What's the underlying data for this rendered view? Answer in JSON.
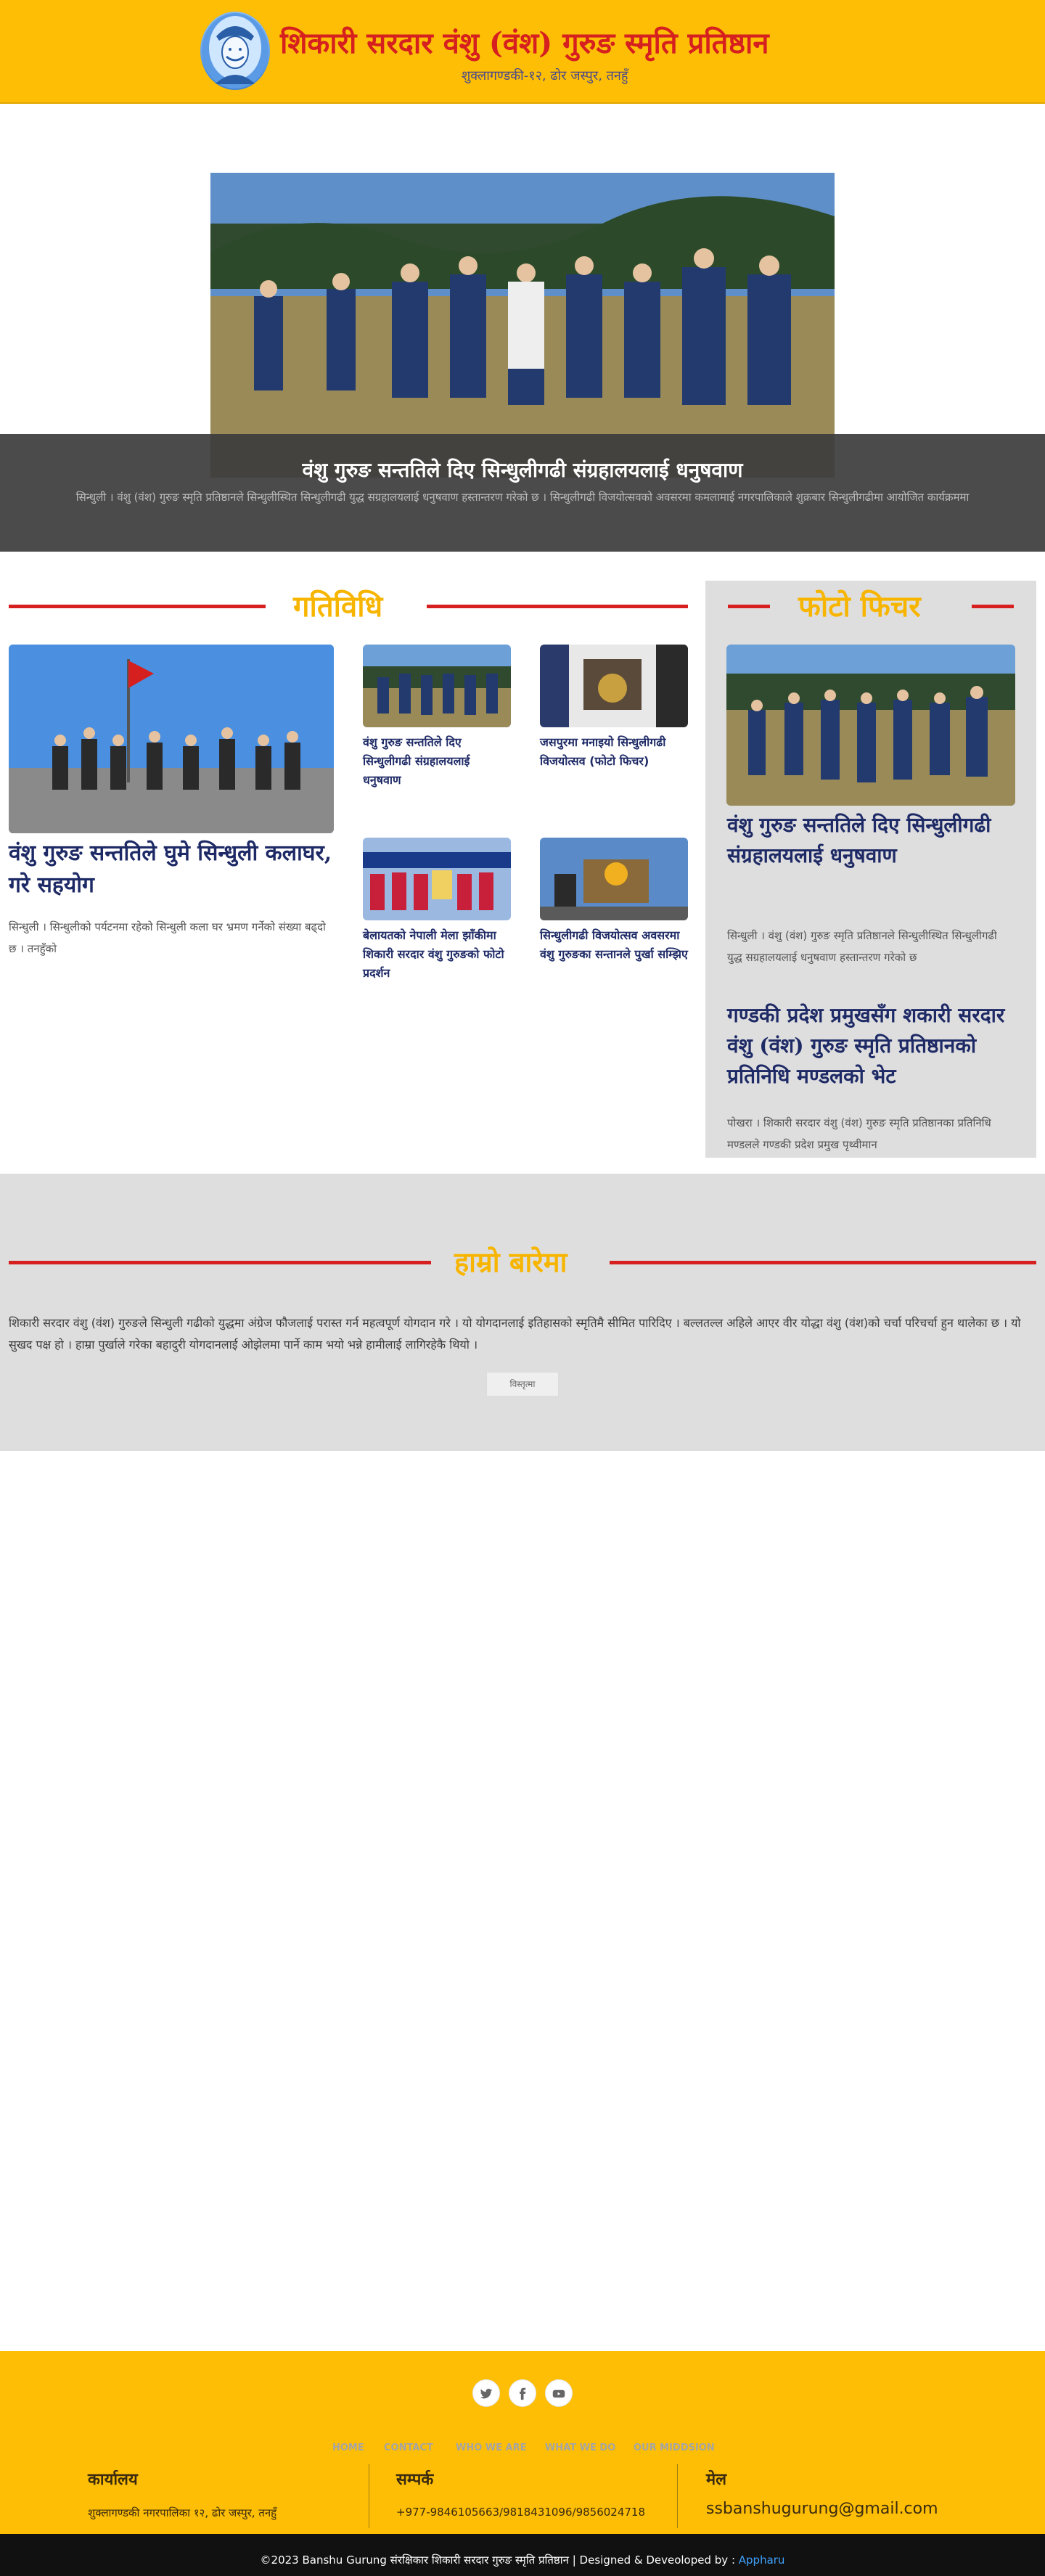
{
  "header": {
    "title": "शिकारी सरदार वंशु (वंश) गुरुङ स्मृति प्रतिष्ठान",
    "subtitle": "शुक्लागण्डकी-१२, ढोर जस्पुर, तनहुँ"
  },
  "hero": {
    "title": "वंशु गुरुङ सन्ततिले दिए सिन्धुलीगढी संग्रहालयलाई धनुषवाण",
    "text": "सिन्धुली । वंशु (वंश) गुरुङ स्मृति प्रतिष्ठानले सिन्धुलीस्थित सिन्धुलीगढी युद्ध सग्रहालयलाई धनुषवाण हस्तान्तरण गरेको छ । सिन्धुलीगढी विजयोत्सवको अवसरमा कमलामाई नगरपालिकाले शुक्रबार सिन्धुलीगढीमा आयोजित कार्यक्रममा"
  },
  "activities": {
    "heading": "गतिविधि",
    "main": {
      "title": "वंशु गुरुङ सन्ततिले घुमे सिन्धुली कलाघर, गरे सहयोग",
      "text": "सिन्धुली । सिन्धुलीको पर्यटनमा रहेको सिन्धुली कला घर भ्रमण गर्नेको संख्या बढ्दो छ । तनहुँको"
    },
    "items": [
      {
        "title": "वंशु गुरुङ सन्ततिले दिए सिन्धुलीगढी संग्रहालयलाई धनुषवाण"
      },
      {
        "title": "जसपुरमा मनाइयो सिन्धुलीगढी विजयोत्सव (फोटो फिचर)"
      },
      {
        "title": "बेलायतको नेपाली मेला झाँकीमा शिकारी सरदार वंशु गुरुङको फोटो प्रदर्शन"
      },
      {
        "title": "सिन्धुलीगढी विजयोत्सव अवसरमा वंशु गुरुङका सन्तानले पुर्खा सम्झिए"
      }
    ]
  },
  "feature": {
    "heading": "फोटो फिचर",
    "items": [
      {
        "title": "वंशु गुरुङ सन्ततिले दिए सिन्धुलीगढी संग्रहालयलाई धनुषवाण",
        "text": "सिन्धुली । वंशु (वंश) गुरुङ स्मृति प्रतिष्ठानले सिन्धुलीस्थित सिन्धुलीगढी युद्ध सग्रहालयलाई धनुषवाण हस्तान्तरण गरेको छ"
      },
      {
        "title": "गण्डकी प्रदेश प्रमुखसँग शकारी सरदार वंशु (वंश) गुरुङ स्मृति प्रतिष्ठानको प्रतिनिधि मण्डलको भेट",
        "text": "पोखरा । शिकारी सरदार वंशु (वंश) गुरुङ स्मृति प्रतिष्ठानका प्रतिनिधि मण्डलले गण्डकी प्रदेश प्रमुख पृथ्वीमान"
      }
    ]
  },
  "about": {
    "heading": "हाम्रो बारेमा",
    "text": "शिकारी सरदार वंशु (वंश) गुरुङले सिन्धुली गढीको युद्धमा अंग्रेज फौजलाई परास्त गर्न महत्वपूर्ण योगदान गरे । यो योगदानलाई इतिहासको स्मृतिमै सीमित पारिदिए । बल्लतल्ल अहिले आएर वीर योद्धा वंशु (वंश)को चर्चा परिचर्चा हुन थालेका छ । यो सुखद पक्ष हो । हाम्रा पुर्खाले गरेका बहादुरी योगदानलाई ओझेलमा पार्ने काम भयो भन्ने हामीलाई लागिरहेकै थियो ।",
    "button": "विस्तृत्मा"
  },
  "footer": {
    "social_icons": [
      "twitter-icon",
      "facebook-icon",
      "youtube-icon"
    ],
    "nav": [
      "HOME",
      "CONTACT",
      "WHO WE ARE",
      "WHAT WE DO",
      "OUR MIDDSION"
    ],
    "office": {
      "title": "कार्यालय",
      "text": "शुक्लागण्डकी नगरपालिका १२, ढोर जस्पुर, तनहुँ"
    },
    "contact": {
      "title": "सम्पर्क",
      "text": "+977-9846105663/9818431096/9856024718"
    },
    "mail": {
      "title": "मेल",
      "text": "ssbanshugurung@gmail.com"
    },
    "copyright": "©2023 Banshu Gurung संरक्षिकार शिकारी सरदार गुरुङ स्मृति प्रतिष्ठान | Designed & Deveoloped by : ",
    "developer": "Appharu"
  },
  "colors": {
    "header_bg": "#fdbe05",
    "title_red": "#d6201f",
    "heading_gold": "#f7b500",
    "navy_text": "#1e2a66",
    "panel_grey": "#dedede",
    "link_blue": "#3fa3ff"
  }
}
